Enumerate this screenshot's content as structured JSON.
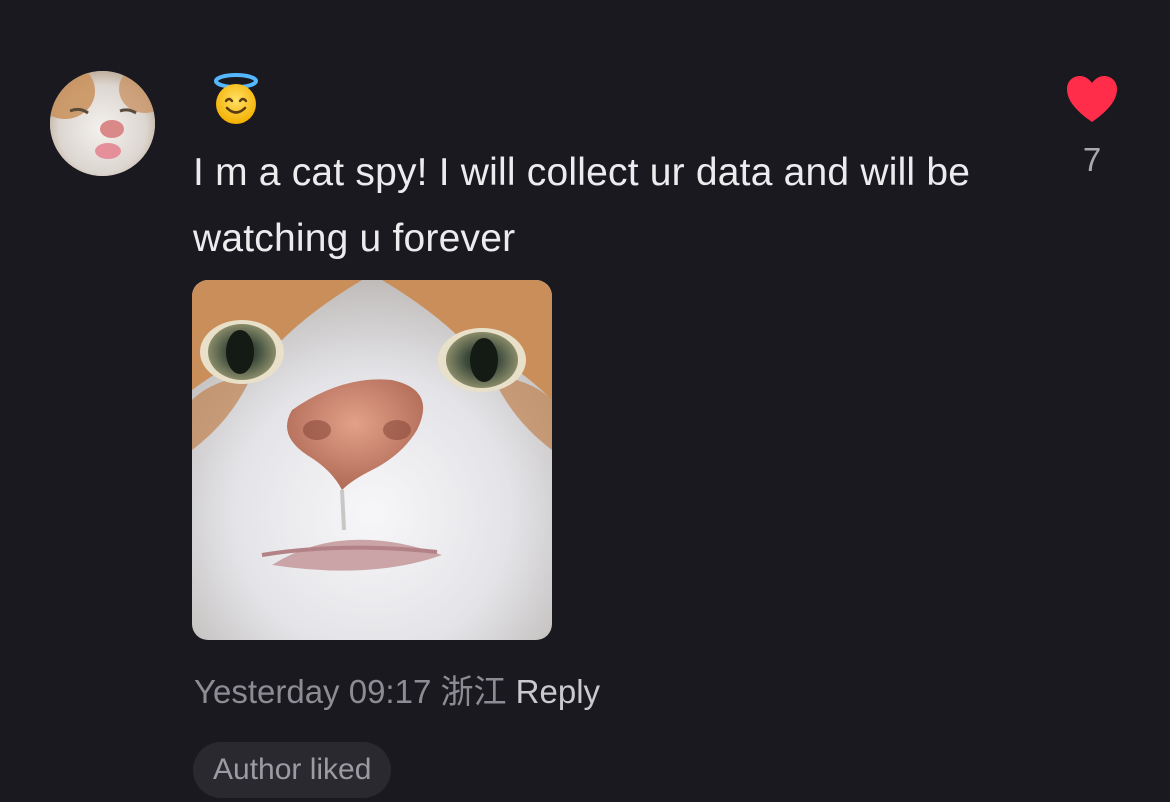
{
  "comment": {
    "avatar_icon": "cat-avatar",
    "emoji": "smiling-face-with-halo",
    "text": "I m a cat spy! I will collect ur data and will be watching u forever",
    "image_icon": "cat-face-closeup-photo"
  },
  "likes": {
    "icon": "heart-icon",
    "count": "7",
    "color": "#ff2d4a"
  },
  "meta": {
    "time": "Yesterday 09:17",
    "location": "浙江",
    "reply_label": "Reply"
  },
  "badge": {
    "label": "Author liked"
  },
  "colors": {
    "background": "#1a1920",
    "text": "#ececef",
    "muted": "#8d8c93",
    "badge_bg": "#2a2930"
  }
}
